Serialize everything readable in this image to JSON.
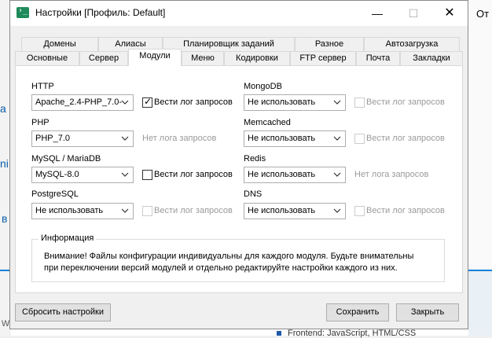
{
  "window": {
    "title": "Настройки [Профиль: Default]",
    "minimize": "—",
    "maximize": "☐",
    "close": "✕"
  },
  "tabs_row1": [
    "Домены",
    "Алиасы",
    "Планировщик заданий",
    "Разное",
    "Автозагрузка"
  ],
  "tabs_row2": [
    "Основные",
    "Сервер",
    "Модули",
    "Меню",
    "Кодировки",
    "FTP сервер",
    "Почта",
    "Закладки"
  ],
  "active_tab": "Модули",
  "modules": {
    "http": {
      "label": "HTTP",
      "value": "Apache_2.4-PHP_7.0-",
      "log_label": "Вести лог запросов",
      "log_checked": true,
      "log_enabled": true
    },
    "php": {
      "label": "PHP",
      "value": "PHP_7.0",
      "no_log": "Нет лога запросов"
    },
    "mysql": {
      "label": "MySQL / MariaDB",
      "value": "MySQL-8.0",
      "log_label": "Вести лог запросов",
      "log_checked": false,
      "log_enabled": true
    },
    "postgresql": {
      "label": "PostgreSQL",
      "value": "Не использовать",
      "log_label": "Вести лог запросов",
      "log_checked": false,
      "log_enabled": false
    },
    "mongodb": {
      "label": "MongoDB",
      "value": "Не использовать",
      "log_label": "Вести лог запросов",
      "log_checked": false,
      "log_enabled": false
    },
    "memcached": {
      "label": "Memcached",
      "value": "Не использовать",
      "log_label": "Вести лог запросов",
      "log_checked": false,
      "log_enabled": false
    },
    "redis": {
      "label": "Redis",
      "value": "Не использовать",
      "no_log": "Нет лога запросов"
    },
    "dns": {
      "label": "DNS",
      "value": "Не использовать",
      "log_label": "Вести лог запросов",
      "log_checked": false,
      "log_enabled": false
    }
  },
  "info": {
    "title": "Информация",
    "line1": "Внимание! Файлы конфигурации индивидуальны для каждого модуля. Будьте внимательны",
    "line2": "при переключении версий модулей и отдельно редактируйте настройки каждого из них."
  },
  "buttons": {
    "reset": "Сбросить настройки",
    "save": "Сохранить",
    "close": "Закрыть"
  },
  "background": {
    "frag_top_right": "От",
    "frag_left_a": "а",
    "frag_left_b": "ni",
    "frag_left_c": "в",
    "frag_left_d": "w",
    "bottom_text": "Frontend: JavaScript, HTML/CSS"
  }
}
